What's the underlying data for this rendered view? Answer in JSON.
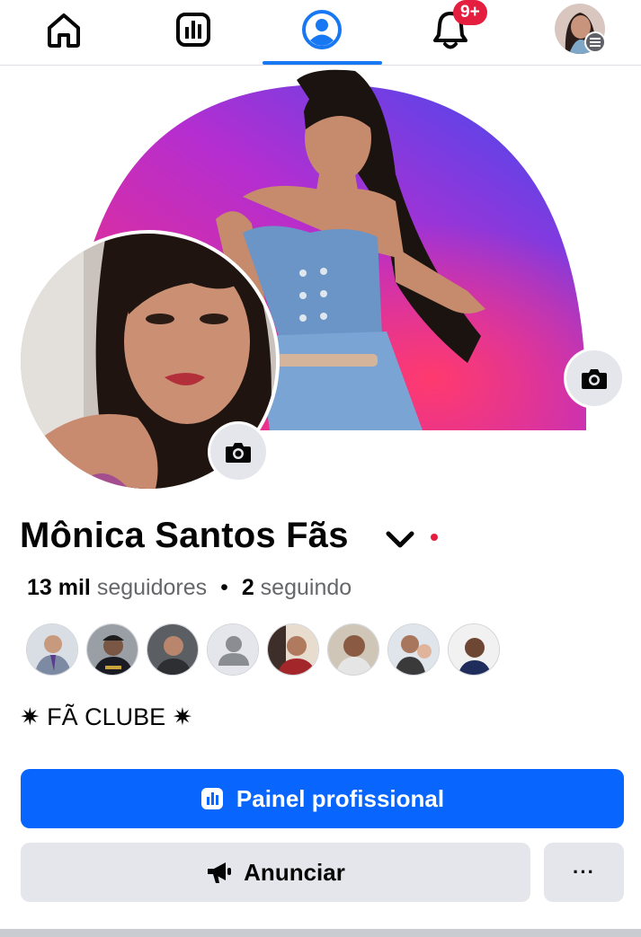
{
  "topnav": {
    "tabs": [
      {
        "icon": "home-icon",
        "label": "Home"
      },
      {
        "icon": "dashboard-icon",
        "label": "Professional dashboard"
      },
      {
        "icon": "profile-icon",
        "label": "Profile",
        "active": true
      },
      {
        "icon": "bell-icon",
        "label": "Notifications",
        "badge": "9+"
      },
      {
        "icon": "avatar-menu-icon",
        "label": "Menu"
      }
    ],
    "notifications_badge": "9+",
    "accent_color": "#1877f2"
  },
  "cover": {
    "gradient_colors": [
      "#ff2e74",
      "#b42ed0",
      "#3b4cf2"
    ],
    "camera_icon": "camera-icon"
  },
  "profile": {
    "name": "Mônica Santos Fãs",
    "followers_count": "13 mil",
    "followers_label": "seguidores",
    "separator": "•",
    "following_count": "2",
    "following_label": "seguindo",
    "bio": "✷ FÃ CLUBE ✷"
  },
  "followers_preview": [
    {
      "icon": "follower-avatar"
    },
    {
      "icon": "follower-avatar"
    },
    {
      "icon": "follower-avatar"
    },
    {
      "icon": "default-avatar-icon"
    },
    {
      "icon": "follower-avatar"
    },
    {
      "icon": "follower-avatar"
    },
    {
      "icon": "follower-avatar"
    },
    {
      "icon": "follower-avatar"
    }
  ],
  "actions": {
    "primary_label": "Painel profissional",
    "primary_color": "#0866ff",
    "advertise_label": "Anunciar",
    "more_label": "···"
  }
}
